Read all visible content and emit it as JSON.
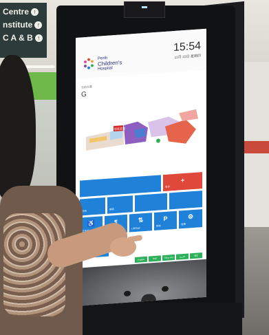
{
  "sign": {
    "lines": [
      "Centre",
      "nstitute",
      "C A & B"
    ]
  },
  "kiosk": {
    "logo": {
      "line1": "Perth",
      "line2": "Children's",
      "line3": "Hospital"
    },
    "clock": "15:54",
    "date": "11月 15日 星期四",
    "location_label": "当前位置",
    "floor_level": "G",
    "map_labels": {
      "red_marker": "您在这里"
    },
    "tiles": [
      {
        "label": "",
        "color": "#1f82d8"
      },
      {
        "label": "急诊",
        "color": "#e0483a"
      },
      {
        "label": "诊所",
        "color": "#1f82d8"
      },
      {
        "label": "病房",
        "color": "#1f82d8"
      },
      {
        "label": "",
        "color": "#1f82d8"
      },
      {
        "label": "",
        "color": "#1f82d8"
      },
      {
        "label": "卫生间",
        "color": "#1f82d8"
      },
      {
        "label": "餐饮",
        "color": "#1f82d8"
      },
      {
        "label": "Lift/Stair",
        "color": "#1f82d8"
      },
      {
        "label": "停车",
        "color": "#1f82d8"
      },
      {
        "label": "设施",
        "color": "#1f82d8"
      }
    ],
    "accessibility_button": "无障碍",
    "languages": [
      "English",
      "中文",
      "Tiếng Việt",
      "العربية",
      "हिंदी"
    ],
    "colors": {
      "tile_blue": "#1f82d8",
      "tile_red": "#e0483a",
      "lang_green": "#2eaf5a"
    }
  }
}
